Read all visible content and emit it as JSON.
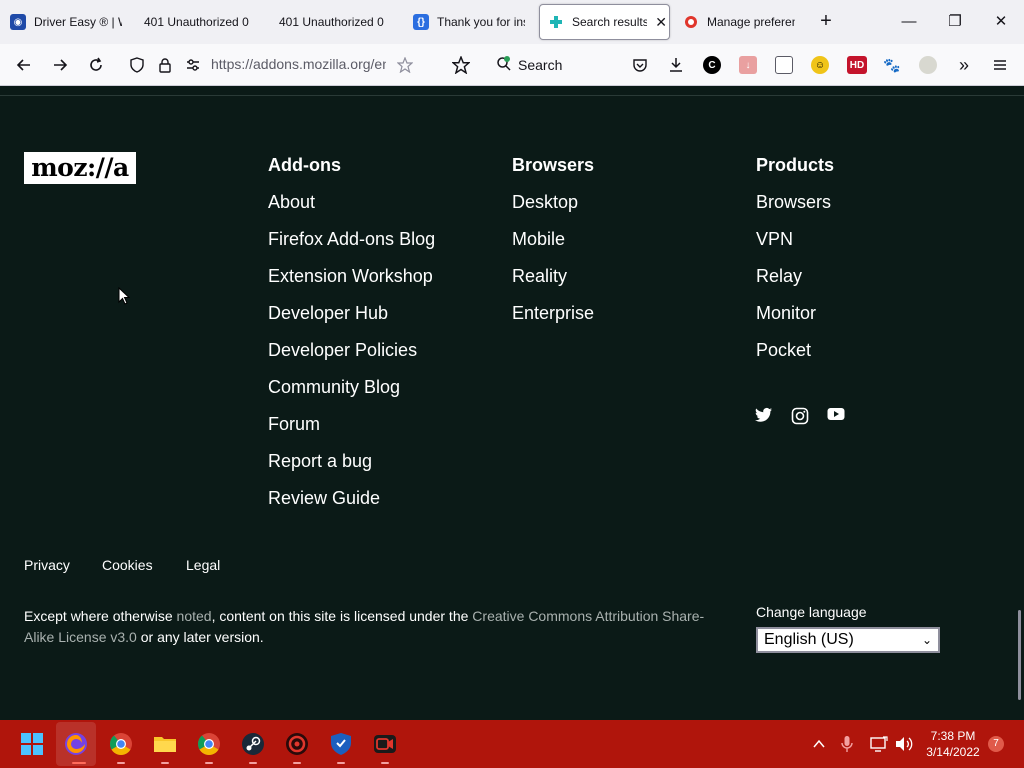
{
  "browser": {
    "tabs": [
      {
        "title": "Driver Easy ® | W",
        "favicon": "driver-easy-icon",
        "active": false
      },
      {
        "title": "401 Unauthorized 0",
        "favicon": "",
        "active": false
      },
      {
        "title": "401 Unauthorized 0",
        "favicon": "",
        "active": false
      },
      {
        "title": "Thank you for ins",
        "favicon": "bracket-icon",
        "active": false
      },
      {
        "title": "Search results",
        "favicon": "puzzle-icon",
        "active": true
      },
      {
        "title": "Manage preferen",
        "favicon": "opera-icon",
        "active": false
      }
    ],
    "new_tab": "+",
    "window_controls": {
      "minimize": "—",
      "restore": "❐",
      "close": "✕"
    },
    "url": "https://addons.mozilla.org/en",
    "search_label": "Search"
  },
  "footer": {
    "logo": "moz://a",
    "columns": [
      {
        "heading": "Add-ons",
        "links": [
          "About",
          "Firefox Add-ons Blog",
          "Extension Workshop",
          "Developer Hub",
          "Developer Policies",
          "Community Blog",
          "Forum",
          "Report a bug",
          "Review Guide"
        ]
      },
      {
        "heading": "Browsers",
        "links": [
          "Desktop",
          "Mobile",
          "Reality",
          "Enterprise"
        ]
      },
      {
        "heading": "Products",
        "links": [
          "Browsers",
          "VPN",
          "Relay",
          "Monitor",
          "Pocket"
        ]
      }
    ],
    "social": [
      "twitter-icon",
      "instagram-icon",
      "youtube-icon"
    ],
    "legal_links": [
      "Privacy",
      "Cookies",
      "Legal"
    ],
    "license": {
      "part1": "Except where otherwise ",
      "link1": "noted",
      "part2": ", content on this site is licensed under the ",
      "link2": "Creative Commons Attribution Share-Alike License v3.0",
      "part3": " or any later version."
    },
    "language_label": "Change language",
    "language_value": "English (US)"
  },
  "taskbar": {
    "time": "7:38 PM",
    "date": "3/14/2022",
    "notification_count": "7"
  },
  "colors": {
    "page_bg": "#0b1a17",
    "taskbar_bg": "#b0150c",
    "link_muted": "#a9b1af"
  }
}
